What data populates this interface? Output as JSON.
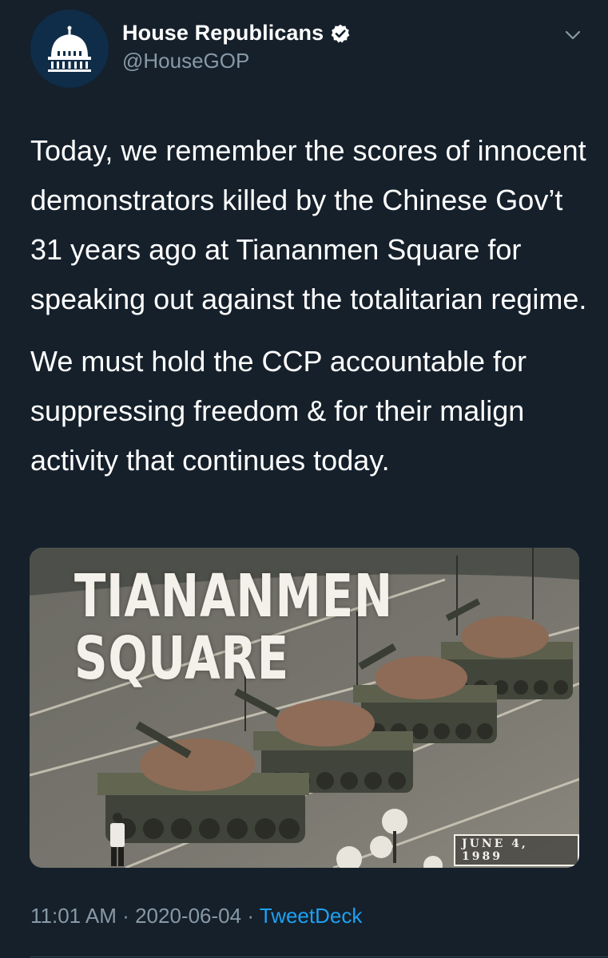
{
  "account": {
    "display_name": "House Republicans",
    "handle": "@HouseGOP",
    "verified_icon": "verified-badge-icon",
    "avatar_icon": "capitol-dome-icon"
  },
  "tweet": {
    "paragraphs": [
      "Today, we remember the scores of innocent demonstrators killed by the Chinese Gov’t 31 years ago at Tiananmen Square for speaking out against the totalitarian regime.",
      "We must hold the CCP accountable for suppressing freedom & for their malign activity that continues today."
    ],
    "media": {
      "title_line1": "TIANANMEN",
      "title_line2": "SQUARE",
      "date_stamp": "JUNE 4, 1989"
    },
    "time": "11:01 AM",
    "separator": "·",
    "date": "2020-06-04",
    "source": "TweetDeck"
  },
  "colors": {
    "background": "#15202b",
    "secondary_text": "#8899a6",
    "link": "#1da1f2"
  }
}
